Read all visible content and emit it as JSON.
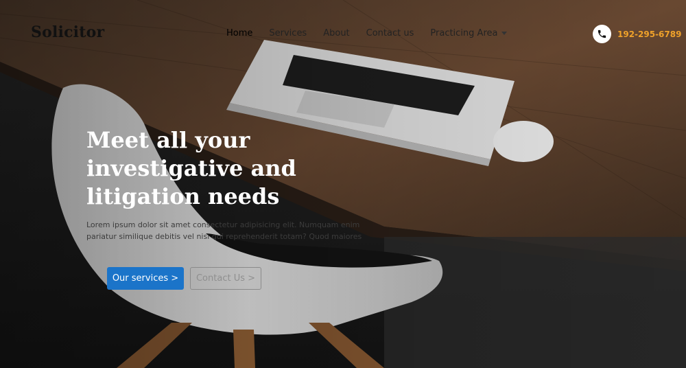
{
  "brand": {
    "name": "Solicitor"
  },
  "nav": {
    "items": [
      {
        "label": "Home",
        "active": true
      },
      {
        "label": "Services"
      },
      {
        "label": "About"
      },
      {
        "label": "Contact us"
      },
      {
        "label": "Practicing Area",
        "has_dropdown": true
      }
    ]
  },
  "contact": {
    "phone": "192-295-6789",
    "icon": "phone-icon",
    "phone_color": "#f0a22a"
  },
  "hero": {
    "headline": "Meet all your investigative and litigation needs",
    "subtext": "Lorem ipsum dolor sit amet consectetur adipisicing elit. Numquam enim pariatur similique debitis vel nisi qui reprehenderit totam? Quod maiores",
    "primary_button": "Our services >",
    "secondary_button": "Contact Us >",
    "primary_color": "#1b74c9"
  }
}
